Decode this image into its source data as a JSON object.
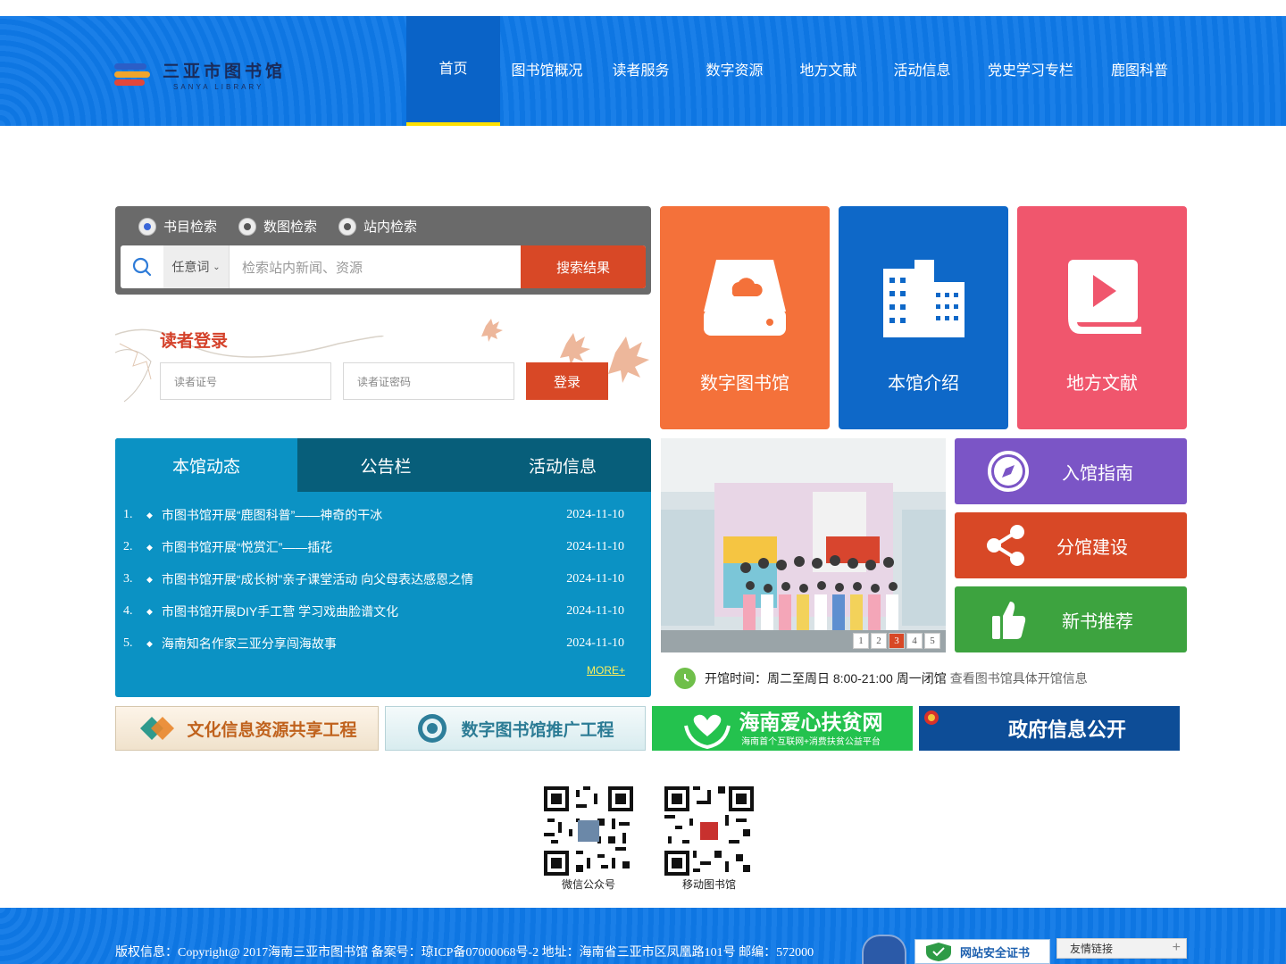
{
  "header": {
    "logo_cn": "三亚市图书馆",
    "logo_en": "SANYA LIBRARY",
    "nav": [
      {
        "label": "首页",
        "active": true
      },
      {
        "label": "图书馆概况"
      },
      {
        "label": "读者服务"
      },
      {
        "label": "数字资源"
      },
      {
        "label": "地方文献"
      },
      {
        "label": "活动信息"
      },
      {
        "label": "党史学习专栏"
      },
      {
        "label": "鹿图科普"
      }
    ]
  },
  "search": {
    "options": [
      "书目检索",
      "数图检索",
      "站内检索"
    ],
    "selected_option": "书目检索",
    "field_select": "任意词",
    "placeholder": "检索站内新闻、资源",
    "button": "搜索结果"
  },
  "login": {
    "title": "读者登录",
    "card_placeholder": "读者证号",
    "password_placeholder": "读者证密码",
    "button": "登录"
  },
  "tiles": [
    {
      "label": "数字图书馆",
      "color": "#f4713a",
      "icon": "hard-drive-cloud-icon"
    },
    {
      "label": "本馆介绍",
      "color": "#0e68c8",
      "icon": "buildings-icon"
    },
    {
      "label": "地方文献",
      "color": "#f0566d",
      "icon": "book-play-icon"
    }
  ],
  "news": {
    "tabs": [
      "本馆动态",
      "公告栏",
      "活动信息"
    ],
    "active_tab": "本馆动态",
    "items": [
      {
        "num": "1.",
        "title": "市图书馆开展“鹿图科普”——神奇的干冰",
        "date": "2024-11-10"
      },
      {
        "num": "2.",
        "title": "市图书馆开展“悦赏汇”——插花",
        "date": "2024-11-10"
      },
      {
        "num": "3.",
        "title": "市图书馆开展“成长树”亲子课堂活动 向父母表达感恩之情",
        "date": "2024-11-10"
      },
      {
        "num": "4.",
        "title": "市图书馆开展DIY手工营 学习戏曲脸谱文化",
        "date": "2024-11-10"
      },
      {
        "num": "5.",
        "title": "海南知名作家三亚分享闯海故事",
        "date": "2024-11-10"
      }
    ],
    "more": "MORE+"
  },
  "slideshow": {
    "pages": [
      "1",
      "2",
      "3",
      "4",
      "5"
    ],
    "current_page": "3"
  },
  "side_buttons": [
    {
      "label": "入馆指南",
      "color": "#7b55c6",
      "icon": "compass-icon"
    },
    {
      "label": "分馆建设",
      "color": "#d84826",
      "icon": "share-icon"
    },
    {
      "label": "新书推荐",
      "color": "#3da33f",
      "icon": "thumbs-up-icon"
    }
  ],
  "hours": {
    "text": "开馆时间：周二至周日 8:00-21:00 周一闭馆",
    "link": "查看图书馆具体开馆信息"
  },
  "banners": [
    {
      "label": "文化信息资源共享工程"
    },
    {
      "label": "数字图书馆推广工程"
    },
    {
      "label": "海南爱心扶贫网",
      "sub": "海南首个互联网+消费扶贫公益平台"
    },
    {
      "label": "政府信息公开"
    }
  ],
  "qr": [
    {
      "label": "微信公众号"
    },
    {
      "label": "移动图书馆"
    }
  ],
  "footer": {
    "copyright": "版权信息：Copyright@ 2017海南三亚市图书馆 备案号：琼ICP备07000068号-2 地址：海南省三亚市区凤凰路101号 邮编：572000",
    "security": "网站安全证书",
    "friend_links": "友情链接"
  }
}
